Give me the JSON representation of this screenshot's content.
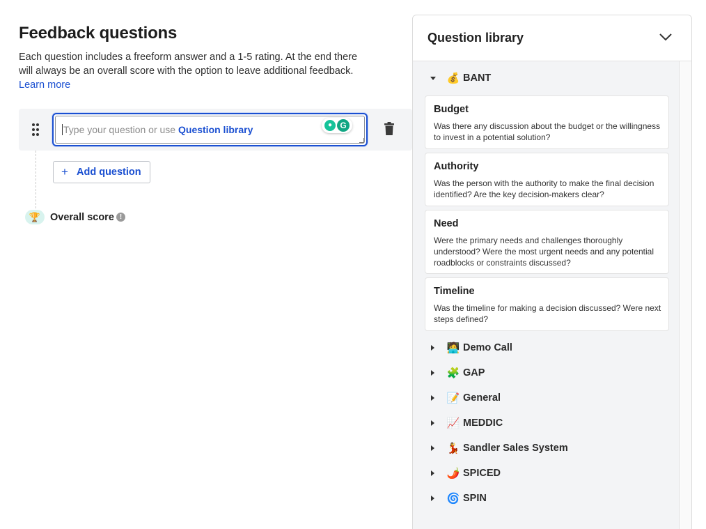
{
  "main": {
    "title": "Feedback questions",
    "description": "Each question includes a freeform answer and a 1-5 rating. At the end there will always be an overall score with the option to leave additional feedback.",
    "learn_more": "Learn more",
    "question_input": {
      "placeholder": "Type your question or use",
      "library_link": "Question library"
    },
    "add_question": "Add question",
    "overall_score": "Overall score"
  },
  "library": {
    "title": "Question library",
    "expanded": {
      "name": "BANT",
      "emoji": "💰",
      "questions": [
        {
          "title": "Budget",
          "description": "Was there any discussion about the budget or the willingness to invest in a potential solution?"
        },
        {
          "title": "Authority",
          "description": "Was the person with the authority to make the final decision identified? Are the key decision-makers clear?"
        },
        {
          "title": "Need",
          "description": "Were the primary needs and challenges thoroughly understood? Were the most urgent needs and any potential roadblocks or constraints discussed?"
        },
        {
          "title": "Timeline",
          "description": "Was the timeline for making a decision discussed? Were next steps defined?"
        }
      ]
    },
    "categories": [
      {
        "name": "Demo Call",
        "emoji": "🧑‍💻"
      },
      {
        "name": "GAP",
        "emoji": "🧩"
      },
      {
        "name": "General",
        "emoji": "📝"
      },
      {
        "name": "MEDDIC",
        "emoji": "📈"
      },
      {
        "name": "Sandler Sales System",
        "emoji": "💃"
      },
      {
        "name": "SPICED",
        "emoji": "🌶️"
      },
      {
        "name": "SPIN",
        "emoji": "🌀"
      }
    ]
  }
}
